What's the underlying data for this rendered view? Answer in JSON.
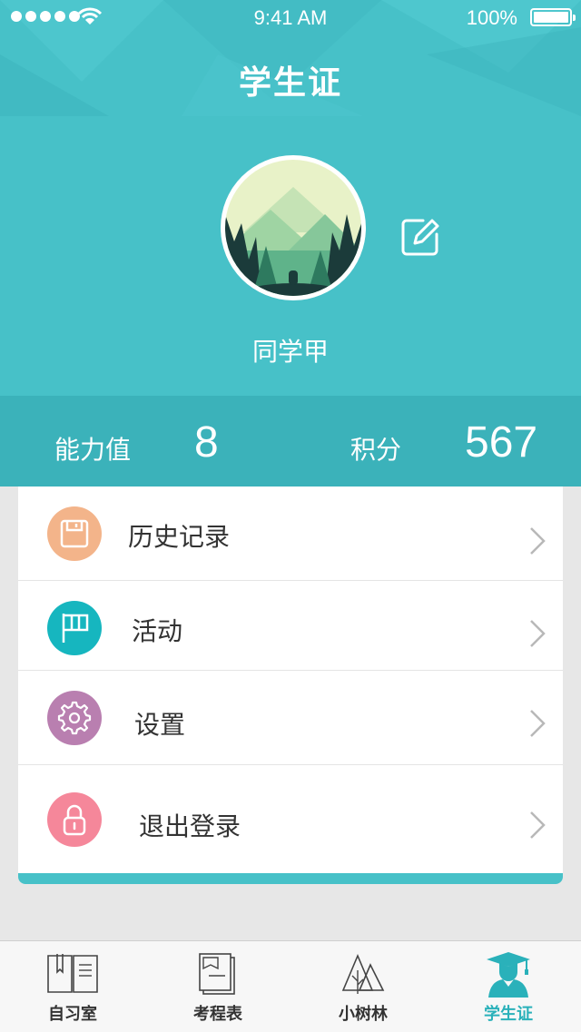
{
  "status_bar": {
    "time": "9:41 AM",
    "battery": "100%"
  },
  "header": {
    "title": "学生证",
    "username": "同学甲"
  },
  "stats": {
    "ability_label": "能力值",
    "ability_value": "8",
    "points_label": "积分",
    "points_value": "567"
  },
  "menu": [
    {
      "label": "历史记录",
      "icon": "floppy-disk-icon",
      "color": "#f3b48a"
    },
    {
      "label": "活动",
      "icon": "flag-icon",
      "color": "#16b6bf"
    },
    {
      "label": "设置",
      "icon": "gear-icon",
      "color": "#b97fb0"
    },
    {
      "label": "退出登录",
      "icon": "lock-icon",
      "color": "#f5879a"
    }
  ],
  "tabs": [
    {
      "label": "自习室",
      "icon": "book-icon",
      "active": false
    },
    {
      "label": "考程表",
      "icon": "schedule-icon",
      "active": false
    },
    {
      "label": "小树林",
      "icon": "forest-icon",
      "active": false
    },
    {
      "label": "学生证",
      "icon": "graduate-icon",
      "active": true
    }
  ],
  "colors": {
    "accent": "#47c1c8",
    "stats_bg": "#3bb2ba",
    "active_tab": "#2ab1ba"
  }
}
